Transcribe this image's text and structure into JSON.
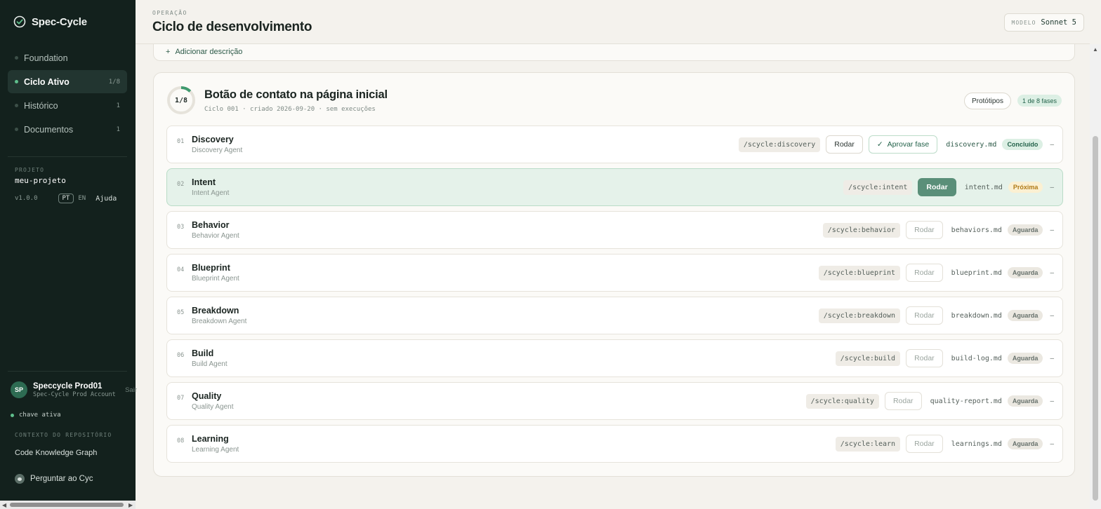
{
  "app": {
    "name": "Spec-Cycle",
    "accent": "#5fbf8c"
  },
  "sidebar": {
    "items": [
      {
        "label": "Foundation",
        "count": ""
      },
      {
        "label": "Ciclo Ativo",
        "count": "1/8"
      },
      {
        "label": "Histórico",
        "count": "1"
      },
      {
        "label": "Documentos",
        "count": "1"
      }
    ],
    "project_label": "PROJETO",
    "project_name": "meu-projeto",
    "version": "v1.0.0",
    "lang_pt": "PT",
    "lang_en": "EN",
    "help": "Ajuda",
    "user": {
      "initials": "SP",
      "name": "Speccycle Prod01",
      "account": "Spec-Cycle Prod Account",
      "signout": "Sair"
    },
    "key_status": "chave ativa",
    "context_label": "CONTEXTO DO REPOSITÓRIO",
    "knowledge_graph": "Code Knowledge Graph",
    "ask": "Perguntar ao Cyc"
  },
  "header": {
    "eyebrow": "OPERAÇÃO",
    "title": "Ciclo de desenvolvimento",
    "model_label": "MODELO",
    "model_value": "Sonnet 5"
  },
  "description": {
    "add_label": "Adicionar descrição"
  },
  "cycle": {
    "progress_label": "1/8",
    "progress_fraction": 0.125,
    "title": "Botão de contato na página inicial",
    "meta": "Ciclo 001 · criado 2026-09-20 · sem execuções",
    "prototypes_button": "Protótipos",
    "phase_badge": "1 de 8 fases",
    "phases": [
      {
        "num": "01",
        "name": "Discovery",
        "agent": "Discovery Agent",
        "command": "/scycle:discovery",
        "run": "Rodar",
        "approve": "Aprovar fase",
        "file": "discovery.md",
        "status": "Concluído",
        "state": "done"
      },
      {
        "num": "02",
        "name": "Intent",
        "agent": "Intent Agent",
        "command": "/scycle:intent",
        "run": "Rodar",
        "file": "intent.md",
        "status": "Próxima",
        "state": "current"
      },
      {
        "num": "03",
        "name": "Behavior",
        "agent": "Behavior Agent",
        "command": "/scycle:behavior",
        "run": "Rodar",
        "file": "behaviors.md",
        "status": "Aguarda",
        "state": "wait"
      },
      {
        "num": "04",
        "name": "Blueprint",
        "agent": "Blueprint Agent",
        "command": "/scycle:blueprint",
        "run": "Rodar",
        "file": "blueprint.md",
        "status": "Aguarda",
        "state": "wait"
      },
      {
        "num": "05",
        "name": "Breakdown",
        "agent": "Breakdown Agent",
        "command": "/scycle:breakdown",
        "run": "Rodar",
        "file": "breakdown.md",
        "status": "Aguarda",
        "state": "wait"
      },
      {
        "num": "06",
        "name": "Build",
        "agent": "Build Agent",
        "command": "/scycle:build",
        "run": "Rodar",
        "file": "build-log.md",
        "status": "Aguarda",
        "state": "wait"
      },
      {
        "num": "07",
        "name": "Quality",
        "agent": "Quality Agent",
        "command": "/scycle:quality",
        "run": "Rodar",
        "file": "quality-report.md",
        "status": "Aguarda",
        "state": "wait"
      },
      {
        "num": "08",
        "name": "Learning",
        "agent": "Learning Agent",
        "command": "/scycle:learn",
        "run": "Rodar",
        "file": "learnings.md",
        "status": "Aguarda",
        "state": "wait"
      }
    ]
  }
}
